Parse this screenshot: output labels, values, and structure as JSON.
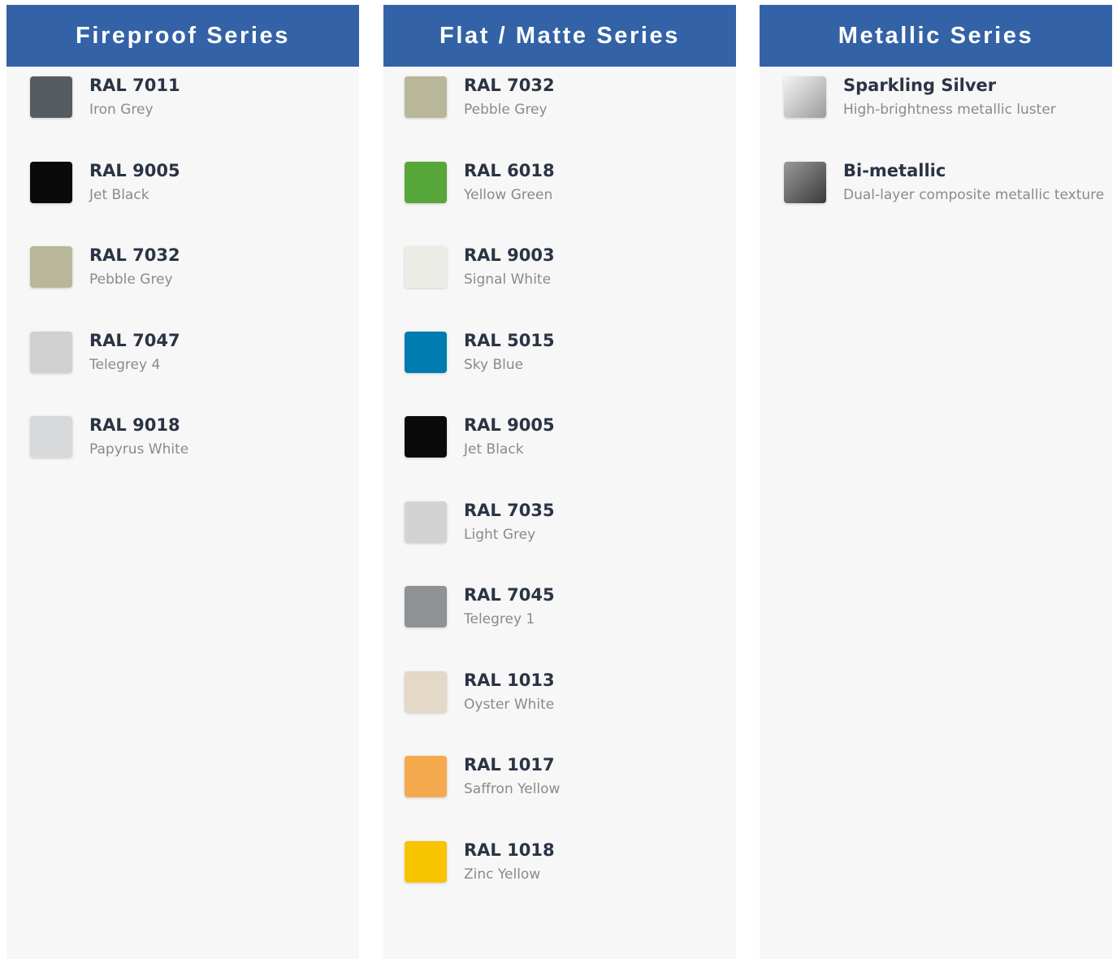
{
  "fireproof": {
    "title": "Fireproof Series",
    "items": [
      {
        "code": "RAL 7011",
        "name": "Iron Grey",
        "color": "#555b61",
        "icon": "iron-grey-swatch"
      },
      {
        "code": "RAL 9005",
        "name": "Jet Black",
        "color": "#0a0a0a",
        "icon": "jet-black-swatch"
      },
      {
        "code": "RAL 7032",
        "name": "Pebble Grey",
        "color": "#b8b799",
        "icon": "pebble-grey-swatch"
      },
      {
        "code": "RAL 7047",
        "name": "Telegrey 4",
        "color": "#d0d0d0",
        "icon": "telegrey-4-swatch"
      },
      {
        "code": "RAL 9018",
        "name": "Papyrus White",
        "color": "#d7d9da",
        "icon": "papyrus-white-swatch"
      }
    ]
  },
  "flat_matte": {
    "title": "Flat / Matte Series",
    "items": [
      {
        "code": "RAL 7032",
        "name": "Pebble Grey",
        "color": "#b8b799",
        "icon": "pebble-grey-swatch"
      },
      {
        "code": "RAL 6018",
        "name": "Yellow Green",
        "color": "#57a639",
        "icon": "yellow-green-swatch"
      },
      {
        "code": "RAL 9003",
        "name": "Signal White",
        "color": "#ecece7",
        "icon": "signal-white-swatch"
      },
      {
        "code": "RAL 5015",
        "name": "Sky Blue",
        "color": "#007cb0",
        "icon": "sky-blue-swatch"
      },
      {
        "code": "RAL 9005",
        "name": "Jet Black",
        "color": "#0a0a0a",
        "icon": "jet-black-swatch"
      },
      {
        "code": "RAL 7035",
        "name": "Light Grey",
        "color": "#d3d3d3",
        "icon": "light-grey-swatch"
      },
      {
        "code": "RAL 7045",
        "name": "Telegrey 1",
        "color": "#8f9295",
        "icon": "telegrey-1-swatch"
      },
      {
        "code": "RAL 1013",
        "name": "Oyster White",
        "color": "#e3d9c6",
        "icon": "oyster-white-swatch"
      },
      {
        "code": "RAL 1017",
        "name": "Saffron Yellow",
        "color": "#f5a94f",
        "icon": "saffron-yellow-swatch"
      },
      {
        "code": "RAL 1018",
        "name": "Zinc Yellow",
        "color": "#f8c400",
        "icon": "zinc-yellow-swatch"
      }
    ]
  },
  "metallic": {
    "title": "Metallic Series",
    "items": [
      {
        "code": "Sparkling Silver",
        "name": "High-brightness metallic luster",
        "gradient": [
          "#f4f4f4",
          "#9b9b9b"
        ],
        "icon": "sparkling-silver-swatch"
      },
      {
        "code": "Bi-metallic",
        "name": "Dual-layer composite metallic texture",
        "gradient": [
          "#9a9a9a",
          "#3a3a3a"
        ],
        "icon": "bi-metallic-swatch"
      }
    ]
  }
}
